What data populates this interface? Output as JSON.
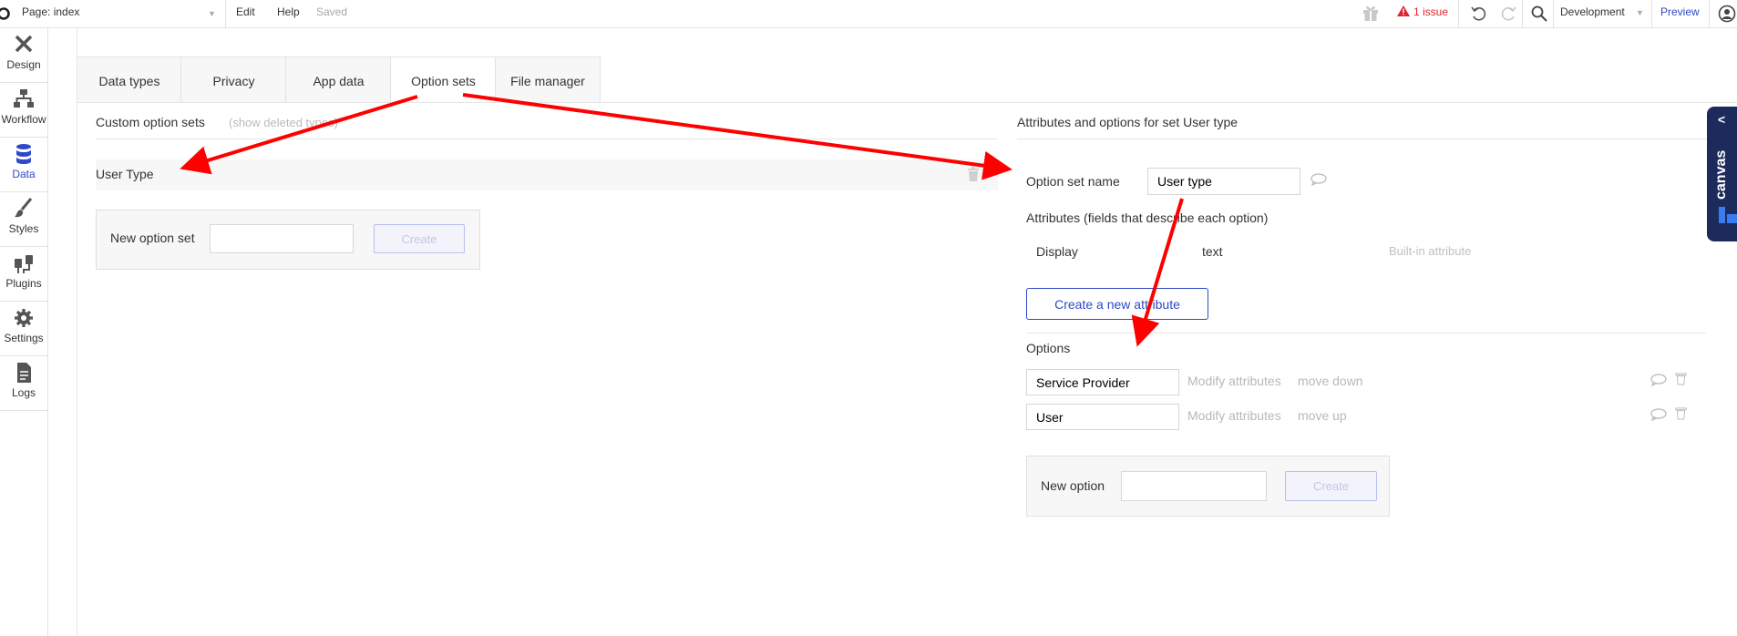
{
  "topbar": {
    "page_label": "Page: index",
    "edit": "Edit",
    "help": "Help",
    "saved": "Saved",
    "issue": "1 issue",
    "environment": "Development",
    "preview": "Preview"
  },
  "sidebar": {
    "items": [
      {
        "label": "Design",
        "icon": "design-icon"
      },
      {
        "label": "Workflow",
        "icon": "workflow-icon"
      },
      {
        "label": "Data",
        "icon": "data-icon",
        "active": true
      },
      {
        "label": "Styles",
        "icon": "brush-icon"
      },
      {
        "label": "Plugins",
        "icon": "plug-icon"
      },
      {
        "label": "Settings",
        "icon": "gear-icon"
      },
      {
        "label": "Logs",
        "icon": "document-icon"
      }
    ]
  },
  "tabs": [
    {
      "label": "Data types"
    },
    {
      "label": "Privacy"
    },
    {
      "label": "App data"
    },
    {
      "label": "Option sets",
      "active": true
    },
    {
      "label": "File manager"
    }
  ],
  "left": {
    "heading": "Custom option sets",
    "show_deleted": "(show deleted types)",
    "sets": [
      {
        "name": "User Type"
      }
    ],
    "new_set_label": "New option set",
    "new_set_value": "",
    "create": "Create"
  },
  "right": {
    "heading": "Attributes and options for set User type",
    "option_set_name_label": "Option set name",
    "option_set_name_value": "User type",
    "attributes_heading": "Attributes (fields that describe each option)",
    "attributes": [
      {
        "name": "Display",
        "type": "text",
        "note": "Built-in attribute"
      }
    ],
    "new_attribute": "Create a new attribute",
    "options_heading": "Options",
    "options": [
      {
        "value": "Service Provider",
        "modify": "Modify attributes",
        "move": "move down"
      },
      {
        "value": "User",
        "modify": "Modify attributes",
        "move": "move up"
      }
    ],
    "new_option_label": "New option",
    "new_option_value": "",
    "create": "Create"
  },
  "canvas_panel": {
    "label": "canvas"
  },
  "colors": {
    "accent": "#2f49c7",
    "issue": "#e0242f",
    "arrow": "#ff0000",
    "canvas_bg": "#1d2a5c"
  }
}
